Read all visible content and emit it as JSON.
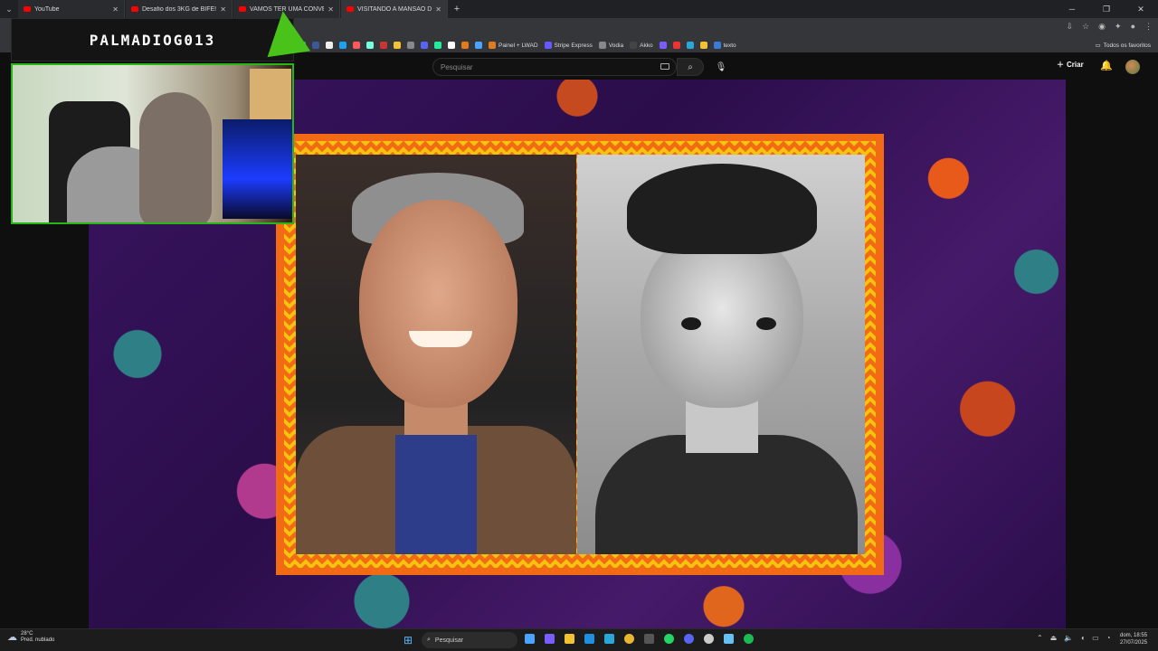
{
  "browser": {
    "tabs": [
      {
        "title": "YouTube",
        "active": false
      },
      {
        "title": "Desafio dos 3KG de BIFE!! Parte",
        "active": false
      },
      {
        "title": "VAMOS TER UMA CONVERSA",
        "active": false
      },
      {
        "title": "VISITANDO A MANSÃO DO",
        "active": true
      }
    ],
    "bookmarks": [
      {
        "label": "Painel + LWAD",
        "color": "#e07b1f"
      },
      {
        "label": "Stripe Express",
        "color": "#635bff"
      },
      {
        "label": "Vodia",
        "color": "#888888"
      },
      {
        "label": "Akko",
        "color": "#444444"
      },
      {
        "label": "texto",
        "color": "#3a7bd5"
      }
    ],
    "all_bookmarks_label": "Todos os favoritos"
  },
  "youtube": {
    "search_placeholder": "Pesquisar",
    "create_label": "Criar"
  },
  "overlay": {
    "streamer_name": "PALMADIOG013"
  },
  "taskbar": {
    "weather_temp": "28°C",
    "weather_desc": "Pred. nublado",
    "search_label": "Pesquisar",
    "time": "18:55",
    "date_line1": "dom,",
    "date_line2": "27/07/2025",
    "apps": [
      {
        "name": "taskview",
        "color": "#4aa3ff"
      },
      {
        "name": "copilot",
        "color": "#7a5cff"
      },
      {
        "name": "explorer",
        "color": "#f2c233"
      },
      {
        "name": "store",
        "color": "#1f8fe0"
      },
      {
        "name": "edge",
        "color": "#2aa7d8"
      },
      {
        "name": "chrome",
        "color": "#e8b631"
      },
      {
        "name": "xbox",
        "color": "#555555"
      },
      {
        "name": "whatsapp",
        "color": "#25d366"
      },
      {
        "name": "discord",
        "color": "#5865f2"
      },
      {
        "name": "obs",
        "color": "#cccccc"
      },
      {
        "name": "steam",
        "color": "#66c0f4"
      },
      {
        "name": "spotify",
        "color": "#1db954"
      }
    ]
  }
}
